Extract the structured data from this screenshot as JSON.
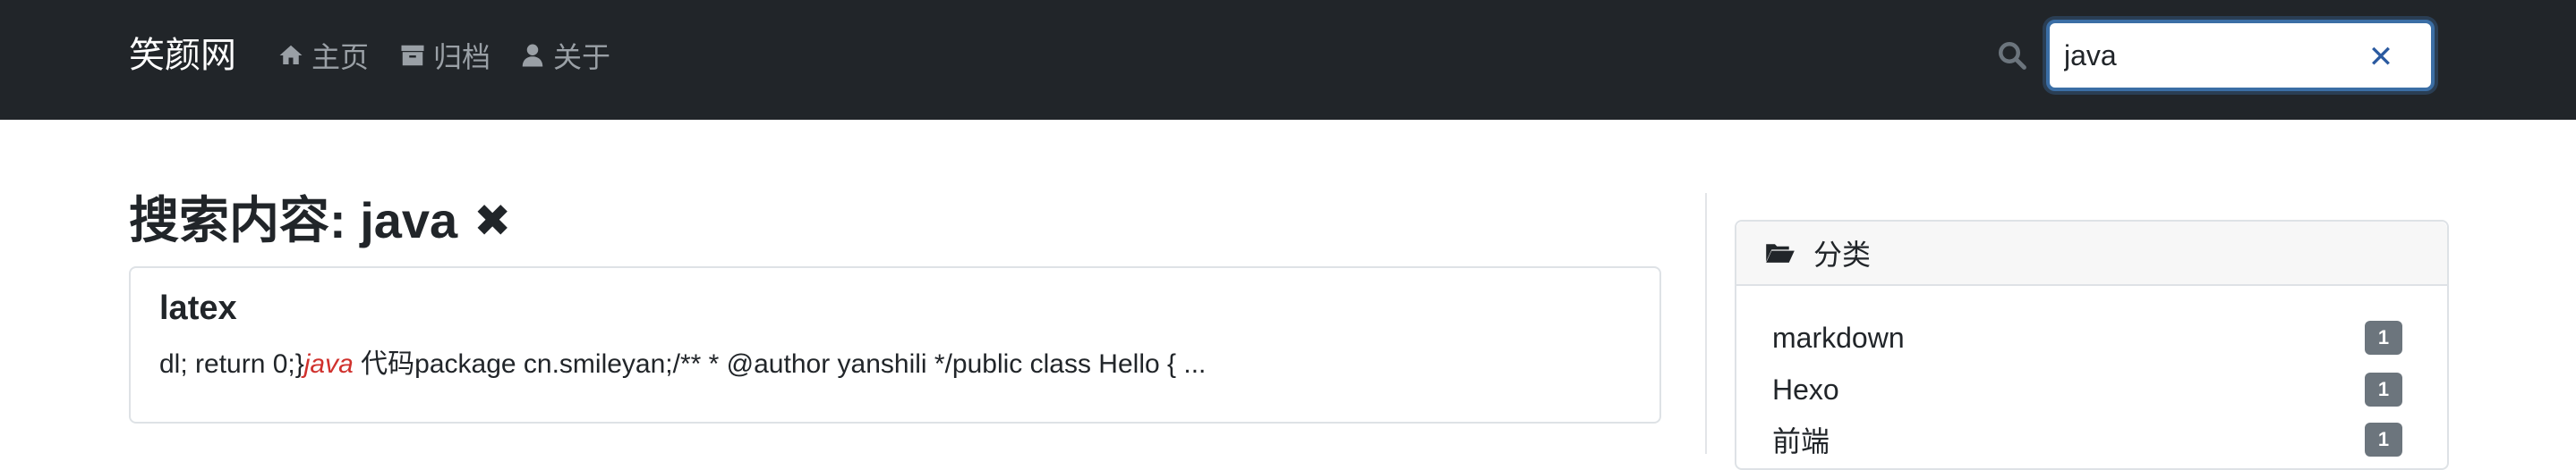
{
  "navbar": {
    "brand": "笑颜网",
    "links": [
      {
        "label": "主页",
        "icon": "home-icon"
      },
      {
        "label": "归档",
        "icon": "archive-icon"
      },
      {
        "label": "关于",
        "icon": "user-icon"
      }
    ],
    "search": {
      "value": "java",
      "icon": "search-icon",
      "clear_label": "✕"
    }
  },
  "main": {
    "search_title": "搜索内容: java",
    "close_label": "✖",
    "results": [
      {
        "title": "latex",
        "snippet_before": "dl; return 0;}",
        "snippet_highlight": "java",
        "snippet_after": " 代码package cn.smileyan;/** * @author yanshili */public class Hello { ..."
      }
    ]
  },
  "sidebar": {
    "categories_title": "分类",
    "categories": [
      {
        "name": "markdown",
        "count": "1"
      },
      {
        "name": "Hexo",
        "count": "1"
      },
      {
        "name": "前端",
        "count": "1"
      }
    ]
  },
  "colors": {
    "navbar_bg": "#212529",
    "highlight": "#d0312d",
    "badge": "#6c757d",
    "search_border": "#3b6ea5"
  }
}
